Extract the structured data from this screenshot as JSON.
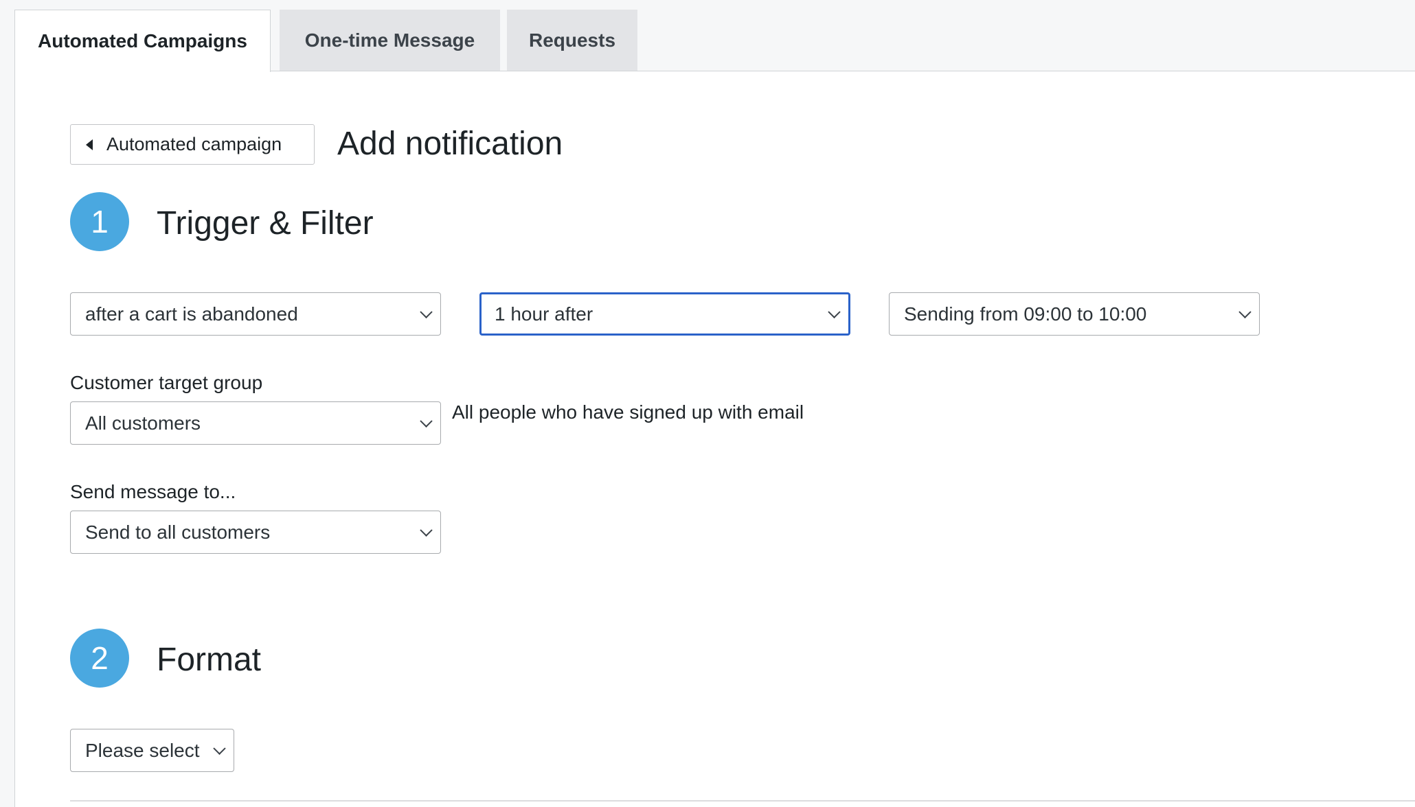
{
  "tabs": [
    {
      "label": "Automated Campaigns",
      "active": true
    },
    {
      "label": "One-time Message",
      "active": false
    },
    {
      "label": "Requests",
      "active": false
    }
  ],
  "header": {
    "back_label": "Automated campaign",
    "title": "Add notification"
  },
  "steps": [
    {
      "number": "1",
      "title": "Trigger & Filter"
    },
    {
      "number": "2",
      "title": "Format"
    }
  ],
  "trigger": {
    "event_value": "after a cart is abandoned",
    "delay_value": "1 hour after",
    "window_value": "Sending from 09:00 to 10:00"
  },
  "target_group": {
    "label": "Customer target group",
    "value": "All customers",
    "description": "All people who have signed up with email"
  },
  "send_to": {
    "label": "Send message to...",
    "value": "Send to all customers"
  },
  "format": {
    "value": "Please select"
  },
  "colors": {
    "accent_circle": "#4aa8e0",
    "focus_border": "#2a62c9"
  }
}
